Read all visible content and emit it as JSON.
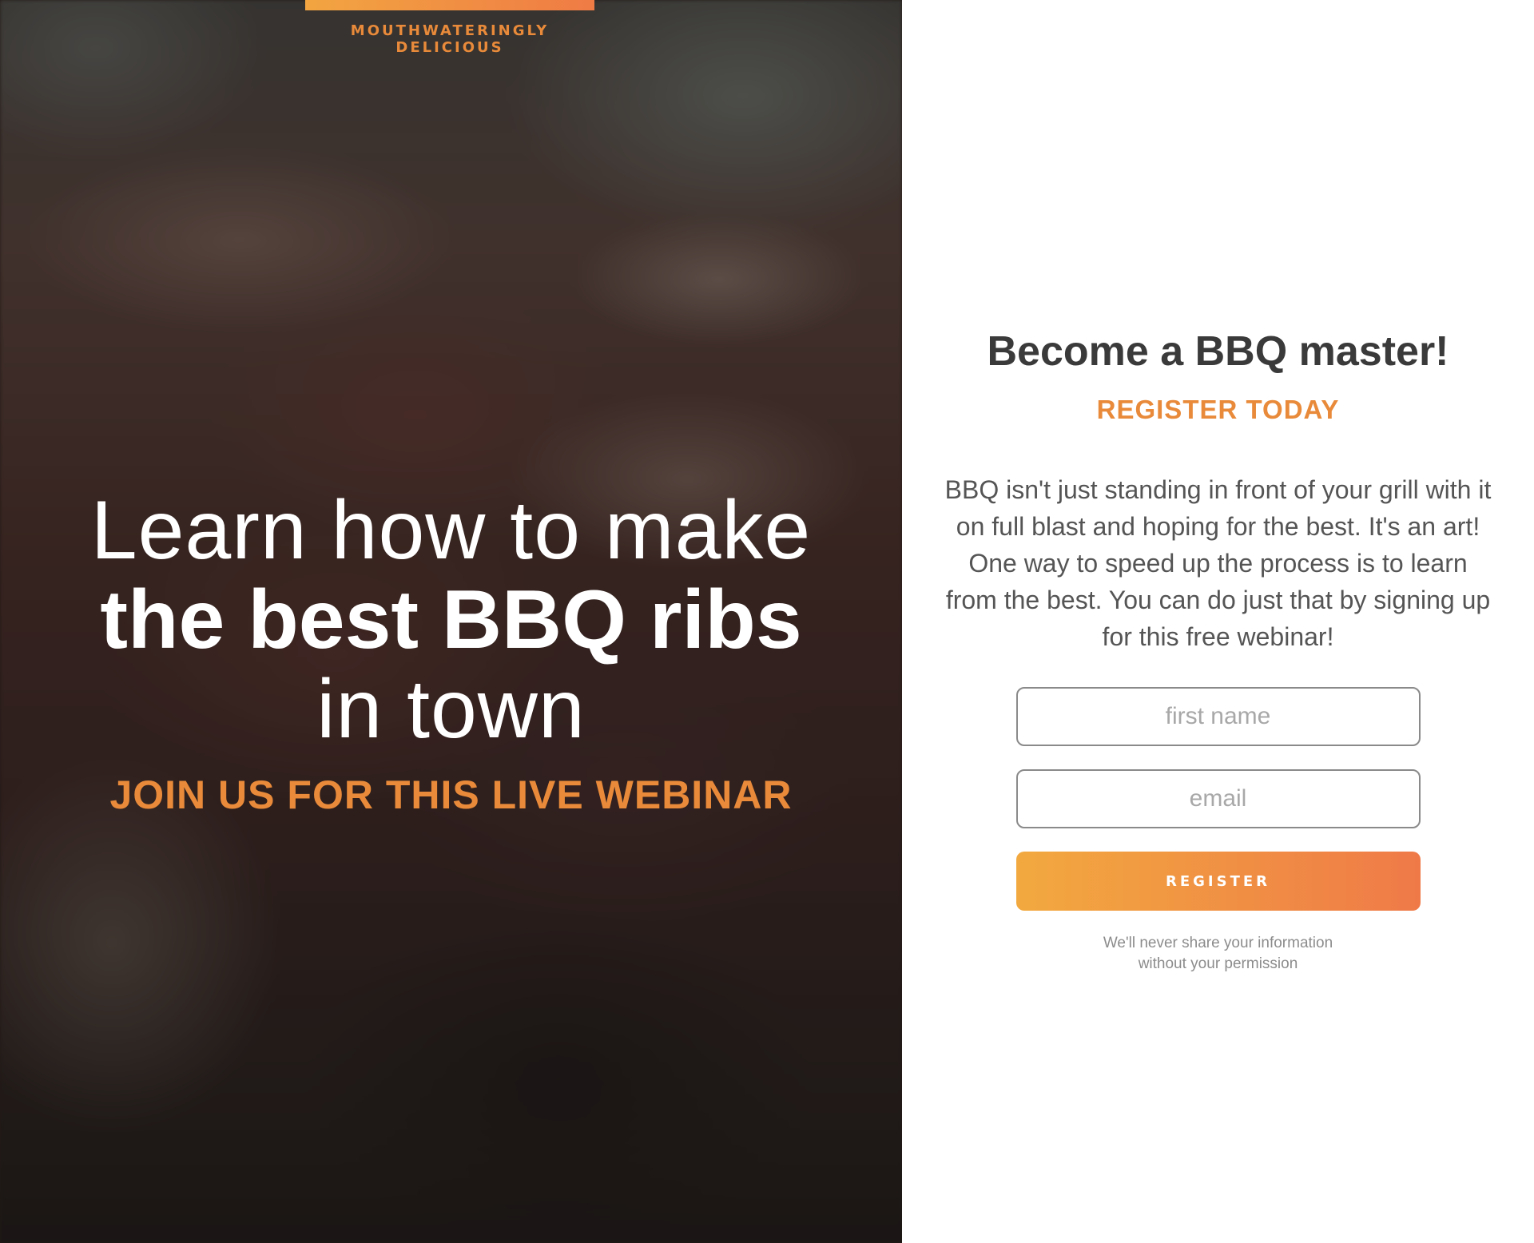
{
  "hero": {
    "tagline": "MOUTHWATERINGLY DELICIOUS",
    "headline_line1": "Learn how to make",
    "headline_line2": "the best BBQ ribs",
    "headline_line3": "in town",
    "cta": "JOIN US FOR THIS LIVE WEBINAR",
    "accent_color": "#e88a3a"
  },
  "form": {
    "title": "Become a BBQ master!",
    "subtitle": "REGISTER TODAY",
    "description": "BBQ isn't just standing in front of your grill with it on full blast and hoping for the best. It's an art! One way to speed up the process is to learn from the best. You can do just that by signing up for this free webinar!",
    "first_name_placeholder": "first name",
    "first_name_value": "",
    "email_placeholder": "email",
    "email_value": "",
    "register_label": "REGISTER",
    "privacy_line1": "We'll never share your information",
    "privacy_line2": "without your permission",
    "button_gradient_start": "#f2a93f",
    "button_gradient_end": "#ef7a48"
  }
}
